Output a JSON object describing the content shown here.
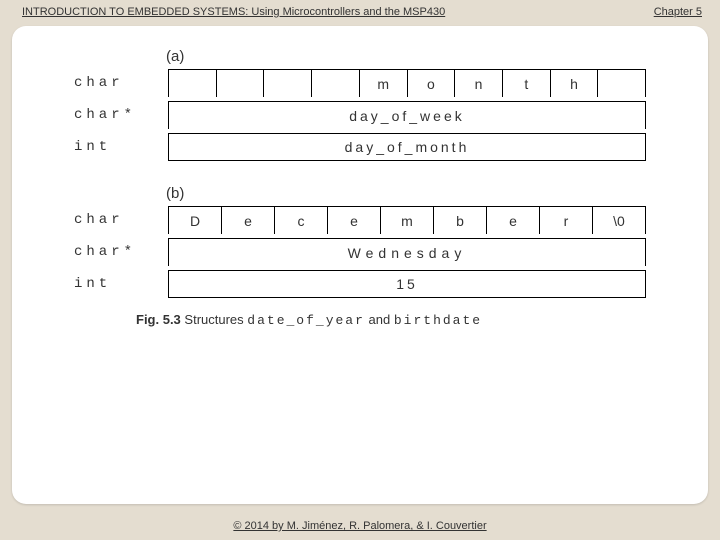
{
  "header": {
    "title": "INTRODUCTION TO EMBEDDED SYSTEMS: Using Microcontrollers and the MSP430",
    "chapter": "Chapter 5"
  },
  "panelA": {
    "label": "(a)",
    "rows": {
      "char": {
        "label": "char",
        "cells": [
          "",
          "",
          "",
          "",
          "m",
          "o",
          "n",
          "t",
          "h",
          ""
        ]
      },
      "charp": {
        "label": "char*",
        "text": "day_of_week"
      },
      "int": {
        "label": "int",
        "text": "day_of_month"
      }
    }
  },
  "panelB": {
    "label": "(b)",
    "rows": {
      "char": {
        "label": "char",
        "cells": [
          "D",
          "e",
          "c",
          "e",
          "m",
          "b",
          "e",
          "r",
          "\\0"
        ]
      },
      "charp": {
        "label": "char*",
        "text": "Wednesday"
      },
      "int": {
        "label": "int",
        "text": "15"
      }
    }
  },
  "caption": {
    "fig": "Fig. 5.3",
    "word1": "Structures",
    "code1": "date_of_year",
    "word2": "and",
    "code2": "birthdate"
  },
  "footer": "© 2014 by M. Jiménez, R. Palomera, & I. Couvertier"
}
